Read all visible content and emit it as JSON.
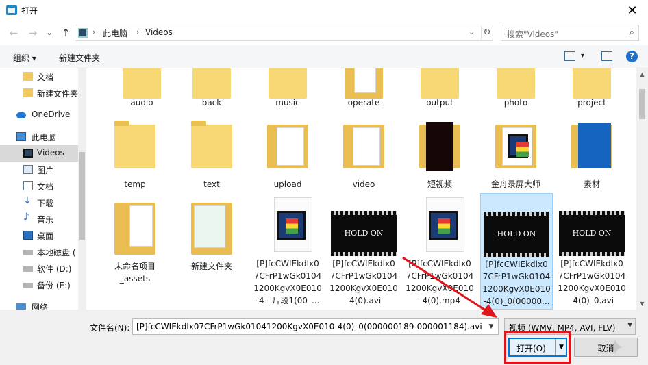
{
  "window": {
    "title": "打开",
    "close": "✕"
  },
  "nav": {
    "back": "←",
    "forward": "→",
    "recent": "⌄",
    "up": "↑",
    "crumbs": [
      "此电脑",
      "Videos"
    ],
    "sep": "›",
    "drop": "⌄",
    "refresh": "↻",
    "search_placeholder": "搜索\"Videos\"",
    "search_icon": "⌕"
  },
  "toolbar": {
    "organize": "组织 ▾",
    "new_folder": "新建文件夹",
    "view_drop": "▾",
    "help": "?"
  },
  "sidebar": {
    "items": [
      {
        "label": "文档",
        "icon": "folder-icon"
      },
      {
        "label": "新建文件夹",
        "icon": "folder-icon"
      },
      {
        "label": "OneDrive",
        "icon": "cloud-icon"
      },
      {
        "label": "此电脑",
        "icon": "computer-icon"
      },
      {
        "label": "Videos",
        "icon": "videos-icon"
      },
      {
        "label": "图片",
        "icon": "pictures-icon"
      },
      {
        "label": "文档",
        "icon": "documents-icon"
      },
      {
        "label": "下载",
        "icon": "download-icon"
      },
      {
        "label": "音乐",
        "icon": "music-icon"
      },
      {
        "label": "桌面",
        "icon": "desktop-icon"
      },
      {
        "label": "本地磁盘 (",
        "icon": "disk-icon"
      },
      {
        "label": "软件 (D:)",
        "icon": "drive-icon"
      },
      {
        "label": "备份 (E:)",
        "icon": "drive-icon"
      },
      {
        "label": "网络",
        "icon": "network-icon"
      }
    ]
  },
  "files": {
    "row1": [
      "audio",
      "back",
      "music",
      "operate",
      "output",
      "photo",
      "project"
    ],
    "row2": [
      "temp",
      "text",
      "upload",
      "video",
      "短视频",
      "金舟录屏大师",
      "素材"
    ],
    "row3": [
      [
        "未命名项目",
        "_assets"
      ],
      [
        "新建文件夹"
      ],
      [
        "[P]fcCWIEkdlx0",
        "7CFrP1wGk0104",
        "1200KgvX0E010",
        "-4 - 片段1(00_..."
      ],
      [
        "[P]fcCWIEkdlx0",
        "7CFrP1wGk0104",
        "1200KgvX0E010",
        "-4(0).avi"
      ],
      [
        "[P]fcCWIEkdlx0",
        "7CFrP1wGk0104",
        "1200KgvX0E010",
        "-4(0).mp4"
      ],
      [
        "[P]fcCWIEkdlx0",
        "7CFrP1wGk0104",
        "1200KgvX0E010",
        "-4(0)_0(00000..."
      ],
      [
        "[P]fcCWIEkdlx0",
        "7CFrP1wGk0104",
        "1200KgvX0E010",
        "-4(0)_0.avi"
      ]
    ],
    "thumb_text": [
      "HOLD ON",
      "HOLD ON",
      "HOLD ON",
      "HOLD ON"
    ]
  },
  "bottom": {
    "filename_label": "文件名(N):",
    "filename_value": "[P]fcCWIEkdlx07CFrP1wGk01041200KgvX0E010-4(0)_0(000000189-000001184).avi",
    "filter_value": "视频 (WMV, MP4, AVI, FLV)",
    "open_label": "打开(O)",
    "cancel_label": "取消",
    "drop": "▼"
  },
  "colors": {
    "accent": "#0078d7",
    "highlight": "#e0151b",
    "selection": "#cce8ff",
    "folder": "#f8d775"
  }
}
